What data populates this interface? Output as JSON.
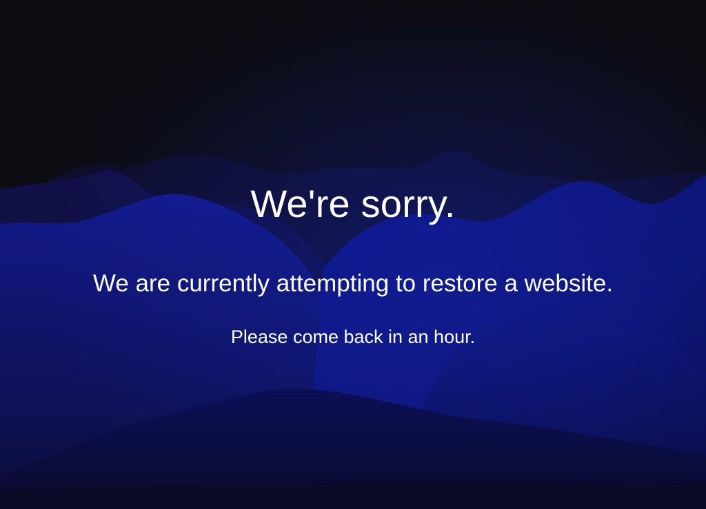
{
  "page": {
    "title": "We're sorry.",
    "subtitle": "We are currently attempting to restore a website.",
    "note": "Please come back in an hour."
  },
  "colors": {
    "background_dark": "#0c0c13",
    "wave_blue": "#0d1a8a",
    "wave_deep": "#0a0f4a",
    "text": "#ffffff"
  }
}
